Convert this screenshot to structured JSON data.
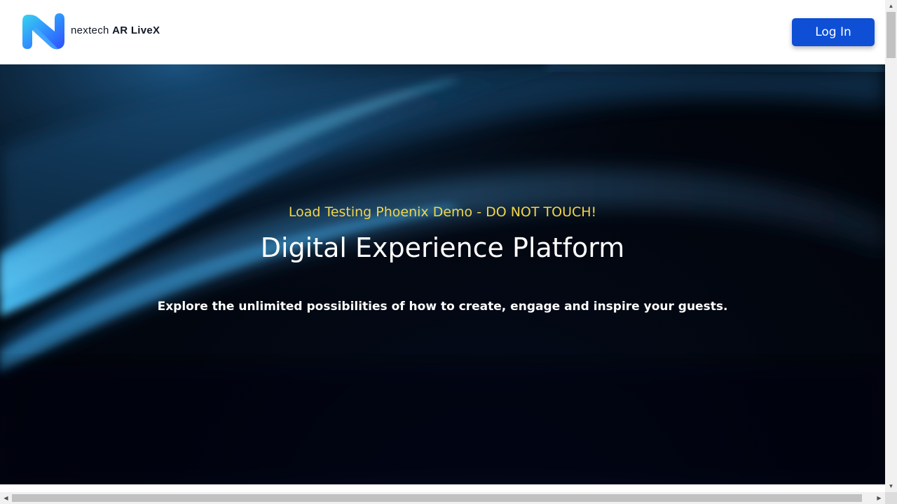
{
  "header": {
    "brand_prefix": "nextech",
    "brand_strong": "AR LiveX",
    "login_label": "Log In",
    "logo_icon": "nextech-logo-icon"
  },
  "hero": {
    "tagline": "Load Testing Phoenix Demo - DO NOT TOUCH!",
    "title": "Digital Experience Platform",
    "subtitle": "Explore the unlimited possibilities of how to create, engage and inspire your guests."
  },
  "colors": {
    "accent": "#0e4fd6",
    "tagline": "#f2d54a",
    "hero_background": "#02060f",
    "logo_gradient_start": "#34c8f0",
    "logo_gradient_end": "#2f5bff"
  },
  "scrollbars": {
    "up_icon": "scroll-up-arrow-icon",
    "down_icon": "scroll-down-arrow-icon",
    "left_icon": "scroll-left-arrow-icon",
    "right_icon": "scroll-right-arrow-icon"
  }
}
